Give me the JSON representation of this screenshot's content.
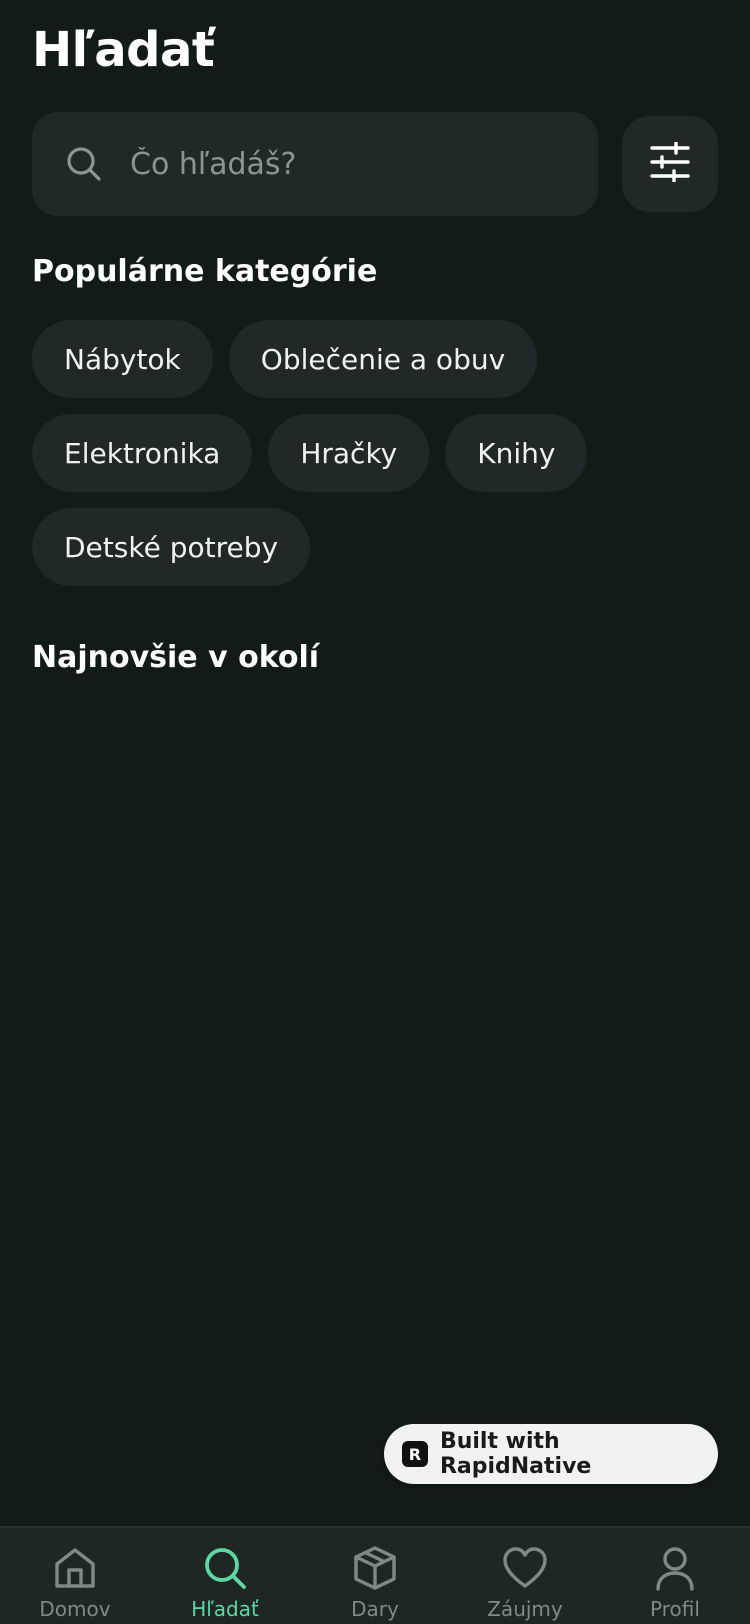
{
  "header": {
    "title": "Hľadať"
  },
  "search": {
    "placeholder": "Čo hľadáš?",
    "value": "",
    "icon": "search-icon"
  },
  "filter_button": {
    "icon": "sliders-icon"
  },
  "categories": {
    "title": "Populárne kategórie",
    "items": [
      "Nábytok",
      "Oblečenie a obuv",
      "Elektronika",
      "Hračky",
      "Knihy",
      "Detské potreby"
    ]
  },
  "nearby": {
    "title": "Najnovšie v okolí"
  },
  "badge": {
    "label": "Built with RapidNative",
    "logo_letter": "R"
  },
  "tabbar": {
    "active": "Hľadať",
    "items": [
      {
        "label": "Domov",
        "icon": "home-icon"
      },
      {
        "label": "Hľadať",
        "icon": "search-icon"
      },
      {
        "label": "Dary",
        "icon": "box-icon"
      },
      {
        "label": "Záujmy",
        "icon": "heart-icon"
      },
      {
        "label": "Profil",
        "icon": "user-icon"
      }
    ]
  },
  "colors": {
    "background": "#131b19",
    "surface": "#202927",
    "accent": "#5ed6a4",
    "muted": "#7f8a86"
  }
}
